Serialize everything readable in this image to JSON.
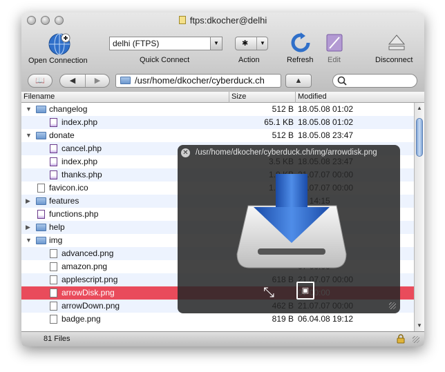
{
  "window": {
    "title": "ftps:dkocher@delhi"
  },
  "toolbar": {
    "open_connection": "Open Connection",
    "quick_connect_value": "delhi (FTPS)",
    "quick_connect_label": "Quick Connect",
    "action_label": "Action",
    "refresh_label": "Refresh",
    "edit_label": "Edit",
    "disconnect_label": "Disconnect"
  },
  "navbar": {
    "path": "/usr/home/dkocher/cyberduck.ch"
  },
  "columns": {
    "filename": "Filename",
    "size": "Size",
    "modified": "Modified"
  },
  "files": [
    {
      "name": "changelog",
      "size": "512 B",
      "modified": "18.05.08 01:02",
      "type": "folder",
      "expanded": true,
      "level": 0
    },
    {
      "name": "index.php",
      "size": "65.1 KB",
      "modified": "18.05.08 01:02",
      "type": "php",
      "level": 1
    },
    {
      "name": "donate",
      "size": "512 B",
      "modified": "18.05.08 23:47",
      "type": "folder",
      "expanded": true,
      "level": 0
    },
    {
      "name": "cancel.php",
      "size": "",
      "modified": "",
      "type": "php",
      "level": 1
    },
    {
      "name": "index.php",
      "size": "3.5 KB",
      "modified": "18.05.08 23:47",
      "type": "php",
      "level": 1
    },
    {
      "name": "thanks.php",
      "size": "1.0 KB",
      "modified": "21.07.07 00:00",
      "type": "php",
      "level": 1
    },
    {
      "name": "favicon.ico",
      "size": "1.0 KB",
      "modified": "21.07.07 00:00",
      "type": "file",
      "level": 0
    },
    {
      "name": "features",
      "size": "",
      "modified": "08 14:15",
      "type": "folder",
      "expanded": false,
      "level": 0
    },
    {
      "name": "functions.php",
      "size": "",
      "modified": "08 15:45",
      "type": "php",
      "level": 0
    },
    {
      "name": "help",
      "size": "",
      "modified": "07 00:00",
      "type": "folder",
      "expanded": false,
      "level": 0
    },
    {
      "name": "img",
      "size": "",
      "modified": "08 16:55",
      "type": "folder",
      "expanded": true,
      "level": 0
    },
    {
      "name": "advanced.png",
      "size": "",
      "modified": "07 00:00",
      "type": "file",
      "level": 1
    },
    {
      "name": "amazon.png",
      "size": "",
      "modified": "07 00:00",
      "type": "file",
      "level": 1
    },
    {
      "name": "applescript.png",
      "size": "618 B",
      "modified": "21.07.07 00:00",
      "type": "file",
      "level": 1
    },
    {
      "name": "arrowDisk.png",
      "size": "",
      "modified": "07 00:00",
      "type": "file",
      "level": 1,
      "selected": true
    },
    {
      "name": "arrowDown.png",
      "size": "462 B",
      "modified": "21.07.07 00:00",
      "type": "file",
      "level": 1
    },
    {
      "name": "badge.png",
      "size": "819 B",
      "modified": "06.04.08 19:12",
      "type": "file",
      "level": 1
    }
  ],
  "status": {
    "count": "81 Files"
  },
  "quicklook": {
    "path": "/usr/home/dkocher/cyberduck.ch/img/arrowdisk.png"
  }
}
